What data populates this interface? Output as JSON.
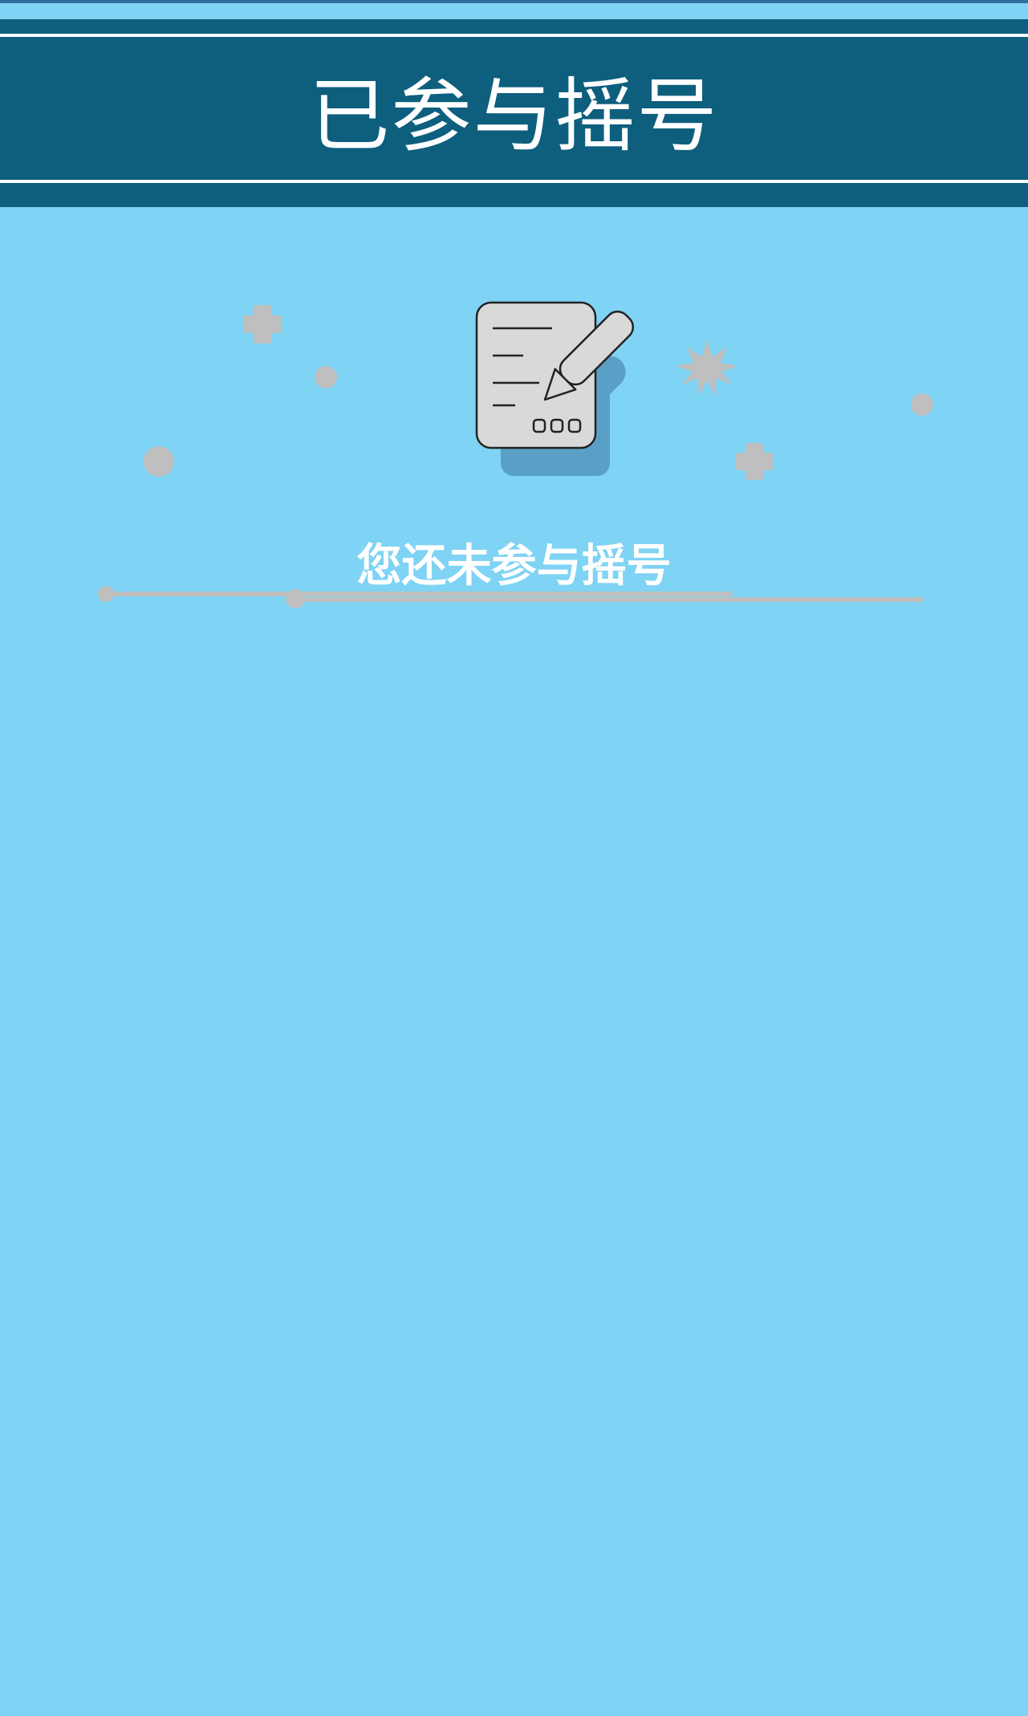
{
  "header": {
    "title": "已参与摇号"
  },
  "empty_state": {
    "message": "您还未参与摇号",
    "icon": "document-edit-icon"
  },
  "colors": {
    "background": "#7fd3f4",
    "header": "#0e5f7e",
    "text": "#ffffff",
    "decoration": "#bfbfbf",
    "icon_shadow": "#5aa0c6"
  }
}
